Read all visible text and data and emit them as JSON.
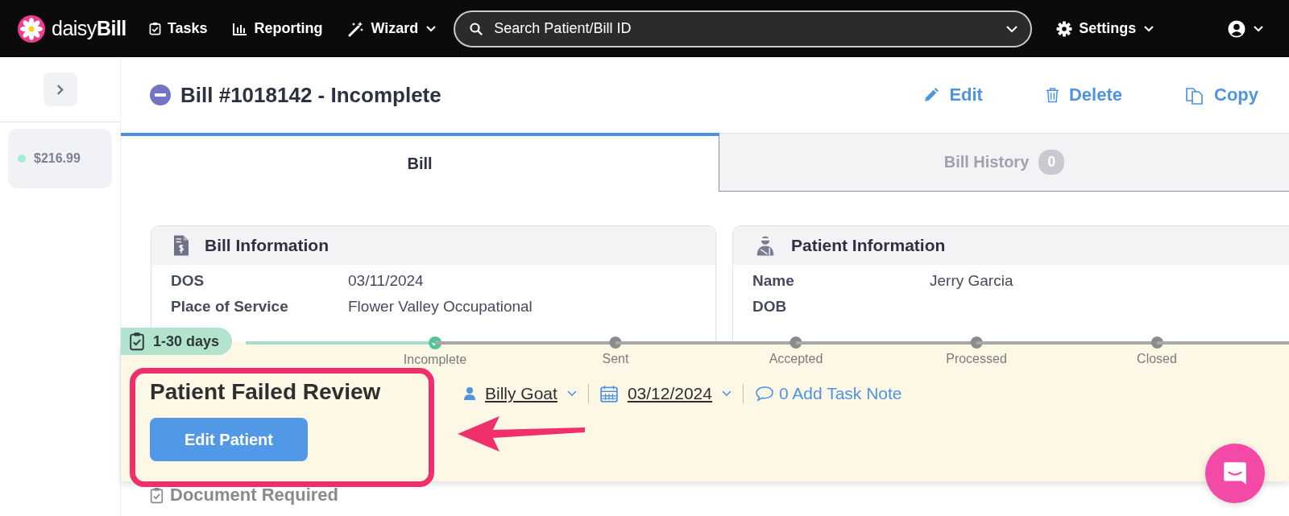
{
  "nav": {
    "brand_light": "daisy",
    "brand_bold": "Bill",
    "items": [
      {
        "label": "Tasks",
        "kind": "tasks"
      },
      {
        "label": "Reporting",
        "kind": "reporting"
      },
      {
        "label": "Wizard",
        "kind": "wizard"
      }
    ],
    "search": {
      "placeholder": "Search Patient/Bill ID"
    },
    "settings": "Settings"
  },
  "sidebar": {
    "bills": [
      {
        "amount": "$216.99",
        "color": "#a6ecd4"
      }
    ]
  },
  "header": {
    "title": "Bill #1018142 - Incomplete",
    "actions": [
      {
        "label": "Edit",
        "kind": "edit"
      },
      {
        "label": "Delete",
        "kind": "delete"
      },
      {
        "label": "Copy",
        "kind": "copy"
      }
    ]
  },
  "tabs": [
    {
      "label": "Bill",
      "selected": true
    },
    {
      "label": "Bill History",
      "count": "0",
      "selected": false
    }
  ],
  "cards": [
    {
      "title": "Bill Information",
      "kind": "bill",
      "rows": [
        {
          "label": "DOS",
          "value": "03/11/2024"
        },
        {
          "label": "Place of Service",
          "value": "Flower Valley Occupational"
        }
      ]
    },
    {
      "title": "Patient Information",
      "kind": "patient",
      "rows": [
        {
          "label": "Name",
          "value": "Jerry Garcia"
        },
        {
          "label": "DOB"
        }
      ]
    }
  ],
  "task": {
    "age": "1-30 days",
    "title": "Patient Failed Review",
    "button": "Edit Patient",
    "assignee": "Billy Goat",
    "due": "03/12/2024",
    "note": "0 Add Task Note",
    "steps": [
      {
        "label": "Incomplete",
        "done": true
      },
      {
        "label": "Sent",
        "done": false
      },
      {
        "label": "Accepted",
        "done": false
      },
      {
        "label": "Processed",
        "done": false
      },
      {
        "label": "Closed",
        "done": false
      }
    ]
  },
  "next_task": "Document Required"
}
